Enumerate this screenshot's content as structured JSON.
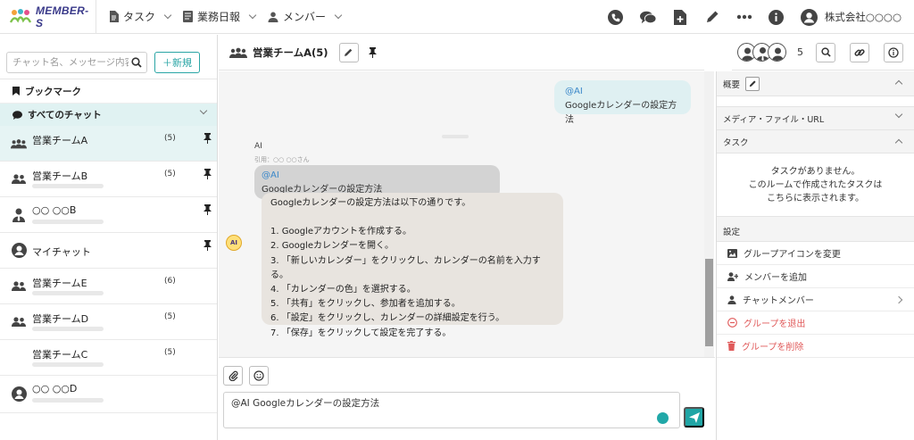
{
  "app": {
    "logo_text": "MEMBER-S"
  },
  "nav": {
    "items": [
      {
        "label": "タスク"
      },
      {
        "label": "業務日報"
      },
      {
        "label": "メンバー"
      }
    ],
    "company": "株式会社○○○○"
  },
  "sidebar": {
    "search_placeholder": "チャット名、メッセージ内容",
    "new_label": "＋新規",
    "bookmark_label": "ブックマーク",
    "all_chats_label": "すべてのチャット",
    "rooms": [
      {
        "name": "営業チームA",
        "count": "(5)",
        "pinned": true,
        "icon": "group-icon",
        "selected": true
      },
      {
        "name": "営業チームB",
        "count": "(5)",
        "pinned": true,
        "icon": "people-icon"
      },
      {
        "name": "○○ ○○B",
        "count": "",
        "pinned": true,
        "icon": "person-tie-icon"
      },
      {
        "name": "マイチャット",
        "count": "",
        "pinned": true,
        "icon": "user-circle-icon"
      },
      {
        "name": "営業チームE",
        "count": "(6)",
        "pinned": false,
        "icon": "people-icon"
      },
      {
        "name": "営業チームD",
        "count": "(5)",
        "pinned": false,
        "icon": "people-icon"
      },
      {
        "name": "営業チームC",
        "count": "(5)",
        "pinned": false,
        "icon": "none"
      },
      {
        "name": "○○ ○○D",
        "count": "",
        "pinned": false,
        "icon": "user-circle-icon"
      }
    ]
  },
  "room": {
    "title": "営業チームA(5)",
    "member_count": "5"
  },
  "messages": {
    "own": {
      "mention": "@AI",
      "text": "Googleカレンダーの設定方法"
    },
    "ai_name": "AI",
    "quote_label": "引用：○○ ○○さん",
    "quote": {
      "mention": "@AI",
      "text": "Googleカレンダーの設定方法"
    },
    "ai_reply": {
      "intro": "Googleカレンダーの設定方法は以下の通りです。",
      "steps": [
        "1. Googleアカウントを作成する。",
        "2. Googleカレンダーを開く。",
        "3. 「新しいカレンダー」をクリックし、カレンダーの名前を入力する。",
        "4. 「カレンダーの色」を選択する。",
        "5. 「共有」をクリックし、参加者を追加する。",
        "6. 「設定」をクリックし、カレンダーの詳細設定を行う。",
        "7. 「保存」をクリックして設定を完了する。"
      ]
    },
    "ai_icon_label": "AI"
  },
  "composer": {
    "text": "@AI Googleカレンダーの設定方法"
  },
  "right_panel": {
    "overview_label": "概要",
    "media_label": "メディア・ファイル・URL",
    "task_label": "タスク",
    "no_task_lines": [
      "タスクがありません。",
      "このルームで作成されたタスクは",
      "こちらに表示されます。"
    ],
    "settings_label": "設定",
    "settings": [
      {
        "label": "グループアイコンを変更",
        "icon": "image-icon",
        "danger": false
      },
      {
        "label": "メンバーを追加",
        "icon": "add-user-icon",
        "danger": false
      },
      {
        "label": "チャットメンバー",
        "icon": "user-icon",
        "danger": false,
        "arrow": true
      },
      {
        "label": "グループを退出",
        "icon": "minus-circle-icon",
        "danger": true
      },
      {
        "label": "グループを削除",
        "icon": "trash-icon",
        "danger": true
      }
    ]
  },
  "colors": {
    "accent": "#20a5a5",
    "selected_room_bg": "#e6f4f4",
    "mention": "#3a87c9",
    "danger": "#e05a5a"
  }
}
